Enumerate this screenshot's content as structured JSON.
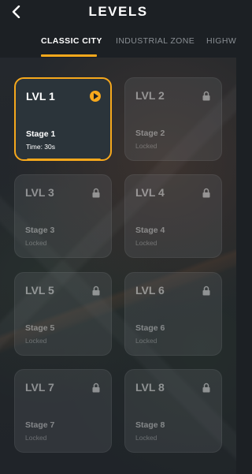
{
  "header": {
    "title": "LEVELS"
  },
  "tabs": [
    {
      "label": "CLASSIC CITY",
      "active": true
    },
    {
      "label": "INDUSTRIAL ZONE",
      "active": false
    },
    {
      "label": "HIGHWAY",
      "active": false
    }
  ],
  "levels": [
    {
      "label": "LVL 1",
      "stage": "Stage 1",
      "info": "Time: 30s",
      "locked": false,
      "progress": 1.0
    },
    {
      "label": "LVL 2",
      "stage": "Stage 2",
      "info": "Locked",
      "locked": true
    },
    {
      "label": "LVL 3",
      "stage": "Stage 3",
      "info": "Locked",
      "locked": true
    },
    {
      "label": "LVL 4",
      "stage": "Stage 4",
      "info": "Locked",
      "locked": true
    },
    {
      "label": "LVL 5",
      "stage": "Stage 5",
      "info": "Locked",
      "locked": true
    },
    {
      "label": "LVL 6",
      "stage": "Stage 6",
      "info": "Locked",
      "locked": true
    },
    {
      "label": "LVL 7",
      "stage": "Stage 7",
      "info": "Locked",
      "locked": true
    },
    {
      "label": "LVL 8",
      "stage": "Stage 8",
      "info": "Locked",
      "locked": true
    }
  ],
  "colors": {
    "accent": "#f6a81c",
    "background": "#1c2024"
  },
  "icons": {
    "back": "chevron-left-icon",
    "lock": "lock-icon",
    "play": "play-icon"
  }
}
